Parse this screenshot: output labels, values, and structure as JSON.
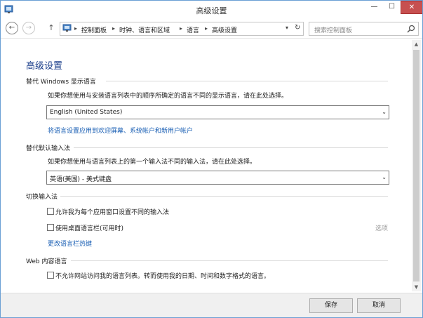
{
  "window": {
    "title": "高级设置",
    "minimize_glyph": "—",
    "maximize_glyph": "☐",
    "close_glyph": "✕"
  },
  "nav": {
    "back_glyph": "←",
    "forward_glyph": "→",
    "up_glyph": "↑",
    "breadcrumbs": [
      "控制面板",
      "时钟、语言和区域",
      "语言",
      "高级设置"
    ],
    "separator": "▸",
    "dropdown_glyph": "▾",
    "refresh_glyph": "↻",
    "search_placeholder": "搜索控制面板"
  },
  "page": {
    "heading": "高级设置"
  },
  "display_language": {
    "title": "替代 Windows 显示语言",
    "description": "如果你想使用与安装语言列表中的顺序所确定的语言不同的显示语言，请在此处选择。",
    "selected": "English (United States)",
    "link": "将语言设置应用到欢迎屏幕、系统帐户和新用户帐户"
  },
  "input_method": {
    "title": "替代默认输入法",
    "description": "如果你想使用与语言列表上的第一个输入法不同的输入法，请在此处选择。",
    "selected": "英语(美国) - 美式键盘"
  },
  "switch_input": {
    "title": "切换输入法",
    "checkbox1": "允许我为每个应用窗口设置不同的输入法",
    "checkbox2": "使用桌面语言栏(可用时)",
    "options": "选项",
    "link": "更改语言栏热键"
  },
  "web_content": {
    "title": "Web 内容语言",
    "checkbox": "不允许网站访问我的语言列表。转而使用我的日期、时间和数字格式的语言。"
  },
  "footer": {
    "save": "保存",
    "cancel": "取消"
  },
  "colors": {
    "heading": "#193d8a",
    "link": "#1a5fb4",
    "close_button": "#c75050"
  }
}
